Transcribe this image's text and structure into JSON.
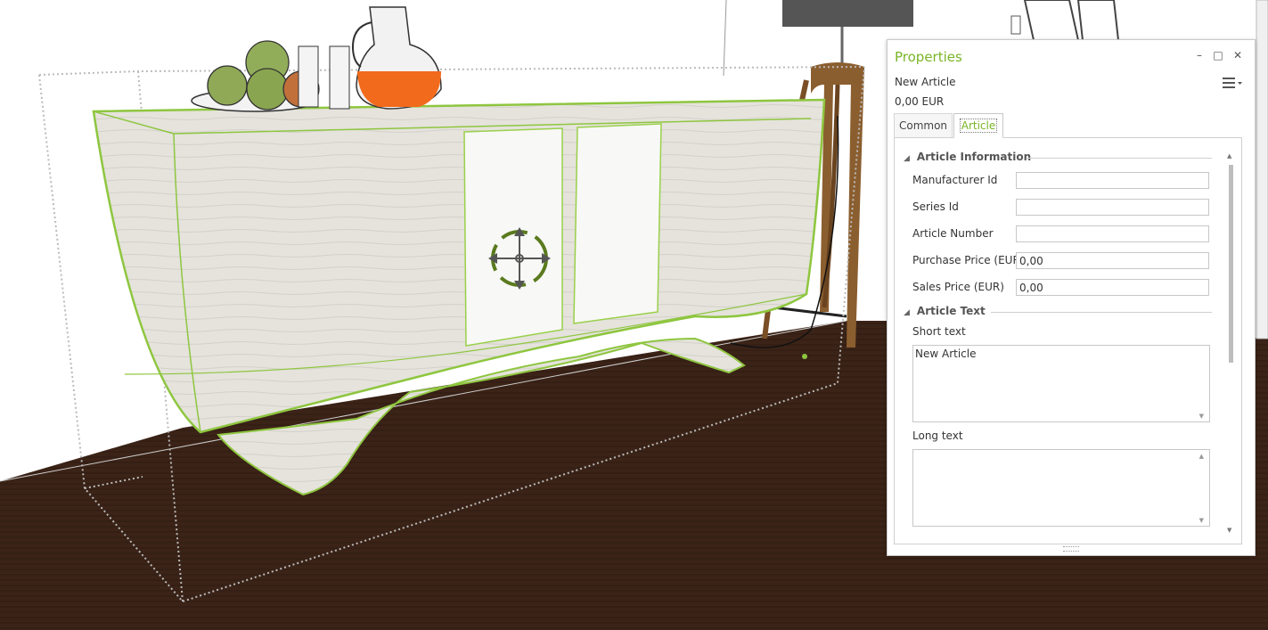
{
  "panel": {
    "title": "Properties",
    "article_name": "New Article",
    "article_price": "0,00 EUR",
    "tabs": [
      {
        "label": "Common"
      },
      {
        "label": "Article"
      }
    ],
    "sections": {
      "article_information": "Article Information",
      "article_text": "Article Text"
    },
    "fields": {
      "manufacturer_id": {
        "label": "Manufacturer Id",
        "value": ""
      },
      "series_id": {
        "label": "Series Id",
        "value": ""
      },
      "article_number": {
        "label": "Article Number",
        "value": ""
      },
      "purchase_price": {
        "label": "Purchase Price (EUR)",
        "value": "0,00"
      },
      "sales_price": {
        "label": "Sales Price (EUR)",
        "value": "0,00"
      }
    },
    "short_text": {
      "label": "Short text",
      "value": "New Article"
    },
    "long_text": {
      "label": "Long text",
      "value": ""
    }
  },
  "colors": {
    "accent": "#7ab526",
    "floor": "#3a2216",
    "wood": "#e6e4dd",
    "juice": "#f26a1b"
  }
}
